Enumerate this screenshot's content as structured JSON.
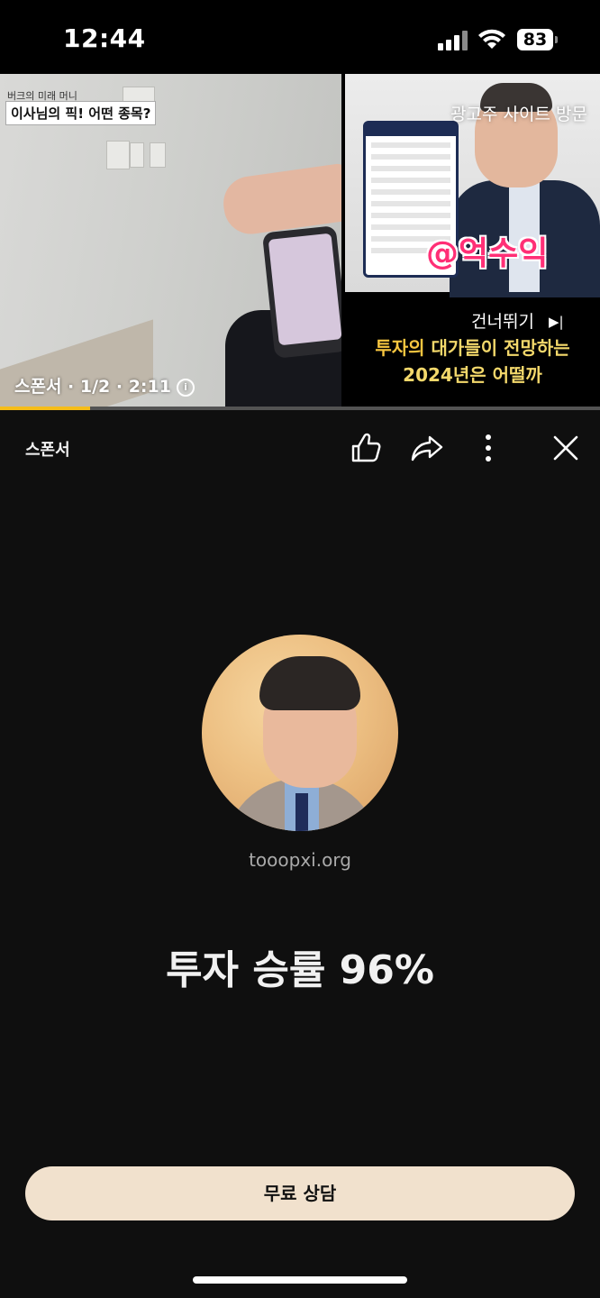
{
  "status_bar": {
    "time": "12:44",
    "battery": "83"
  },
  "video": {
    "left_overlay_small": "버크의 미래 머니",
    "left_caption": "이사님의 픽! 어떤 종목?",
    "advertiser_link": "광고주 사이트 방문",
    "skip_label": "건너뛰기",
    "skip_icon": "▶|",
    "promo_tag": "@억수익",
    "headline_line1_highlight": "투자의",
    "headline_line1_rest": " 대가들이 전망하는",
    "headline_line2": "2024년은 어떨까",
    "ad_info": "스폰서 · 1/2 · 2:11",
    "progress": 0.15,
    "progress_color": "#f6bd18"
  },
  "ad_panel": {
    "sponsor_label": "스폰서",
    "advertiser_domain": "tooopxi.org",
    "headline": "투자 승률 96%",
    "cta_label": "무료 상담"
  }
}
